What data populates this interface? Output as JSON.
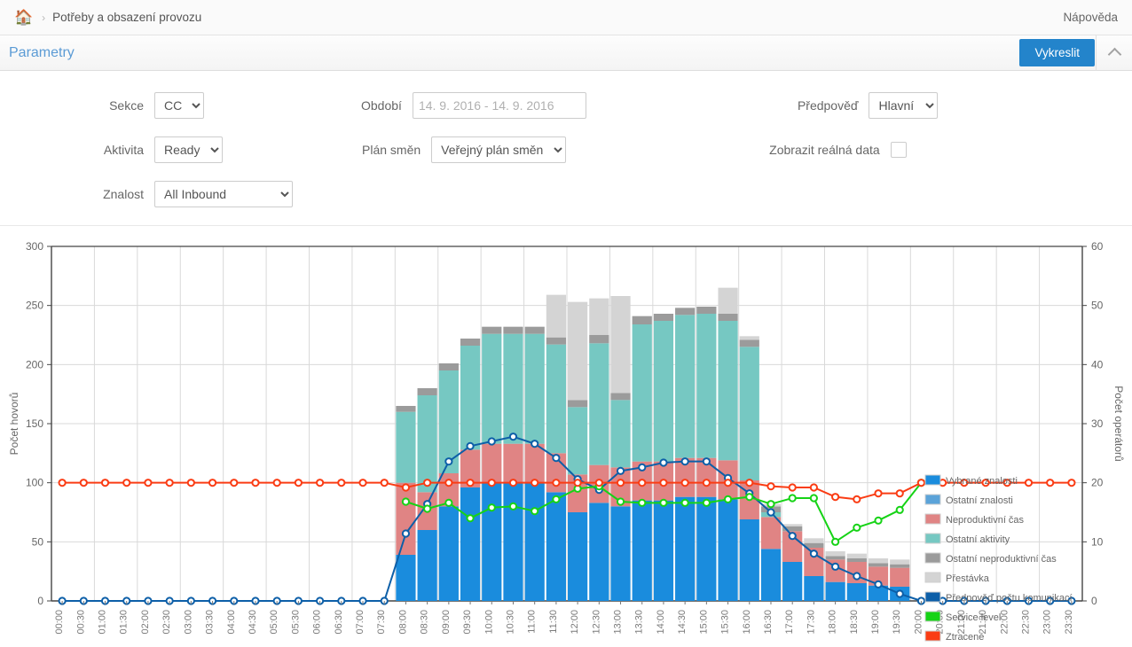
{
  "breadcrumb": {
    "home_icon": "home-icon",
    "separator": "›",
    "title": "Potřeby a obsazení provozu",
    "help": "Nápověda"
  },
  "panel": {
    "title": "Parametry",
    "draw_button": "Vykreslit",
    "collapse_icon": "chevron-up-icon"
  },
  "form": {
    "sekce_label": "Sekce",
    "sekce_value": "CC",
    "aktivita_label": "Aktivita",
    "aktivita_value": "Ready",
    "znalost_label": "Znalost",
    "znalost_value": "All Inbound",
    "obdobi_label": "Období",
    "obdobi_placeholder": "14. 9. 2016 - 14. 9. 2016",
    "obdobi_value": "",
    "plan_smen_label": "Plán směn",
    "plan_smen_value": "Veřejný plán směn",
    "predpoved_label": "Předpověď",
    "predpoved_value": "Hlavní",
    "realna_data_label": "Zobrazit reálná data",
    "realna_data_checked": false
  },
  "chart_data": {
    "type": "bar",
    "title": "",
    "xlabel": "",
    "ylabel": "Počet hovorů",
    "y2label": "Počet operátorů",
    "ylim": [
      0,
      300
    ],
    "y2lim": [
      0,
      60
    ],
    "yticks": [
      0,
      50,
      100,
      150,
      200,
      250,
      300
    ],
    "y2ticks": [
      0,
      10,
      20,
      30,
      40,
      50,
      60
    ],
    "grid": true,
    "legend_position": "top-right",
    "categories": [
      "00:00",
      "00:30",
      "01:00",
      "01:30",
      "02:00",
      "02:30",
      "03:00",
      "03:30",
      "04:00",
      "04:30",
      "05:00",
      "05:30",
      "06:00",
      "06:30",
      "07:00",
      "07:30",
      "08:00",
      "08:30",
      "09:00",
      "09:30",
      "10:00",
      "10:30",
      "11:00",
      "11:30",
      "12:00",
      "12:30",
      "13:00",
      "13:30",
      "14:00",
      "14:30",
      "15:00",
      "15:30",
      "16:00",
      "16:30",
      "17:00",
      "17:30",
      "18:00",
      "18:30",
      "19:00",
      "19:30",
      "20:00",
      "20:30",
      "21:00",
      "21:30",
      "22:00",
      "22:30",
      "23:00",
      "23:30"
    ],
    "legend": [
      {
        "label": "Vybrané znalosti",
        "color": "#1a8cdd"
      },
      {
        "label": "Ostatní znalosti",
        "color": "#5ba3d9"
      },
      {
        "label": "Neproduktivní čas",
        "color": "#e08484"
      },
      {
        "label": "Ostatní aktivity",
        "color": "#76c8c2"
      },
      {
        "label": "Ostatní neproduktivní čas",
        "color": "#9b9b9b"
      },
      {
        "label": "Přestávka",
        "color": "#d4d4d4"
      },
      {
        "label": "Předpověď počtu komunikací",
        "color": "#0d5fa8"
      },
      {
        "label": "Service level",
        "color": "#16d316"
      },
      {
        "label": "Ztracené",
        "color": "#fa3c14"
      }
    ],
    "series": [
      {
        "name": "Vybrané znalosti",
        "type": "bar",
        "axis": "right",
        "color": "#1a8cdd",
        "values": [
          0,
          0,
          0,
          0,
          0,
          0,
          0,
          0,
          0,
          0,
          0,
          0,
          0,
          0,
          0,
          0,
          7.8,
          12,
          16,
          19.2,
          20,
          20,
          20,
          18.4,
          15,
          16.6,
          16,
          17,
          17,
          17.6,
          17.6,
          17.2,
          13.8,
          8.8,
          6.6,
          4.2,
          3.2,
          3,
          2.6,
          2.4,
          0,
          0,
          0,
          0,
          0,
          0,
          0,
          0
        ]
      },
      {
        "name": "Ostatní znalosti",
        "type": "bar",
        "axis": "right",
        "color": "#5ba3d9",
        "values": [
          0,
          0,
          0,
          0,
          0,
          0,
          0,
          0,
          0,
          0,
          0,
          0,
          0,
          0,
          0,
          0,
          0,
          0,
          0,
          0,
          0,
          0,
          0,
          0,
          0,
          0,
          0,
          0,
          0,
          0,
          0,
          0,
          0,
          0,
          0,
          0,
          0,
          0,
          0,
          0,
          0,
          0,
          0,
          0,
          0,
          0,
          0,
          0
        ]
      },
      {
        "name": "Neproduktivní čas",
        "type": "bar",
        "axis": "right",
        "color": "#e08484",
        "values": [
          0,
          0,
          0,
          0,
          0,
          0,
          0,
          0,
          0,
          0,
          0,
          0,
          0,
          0,
          0,
          0,
          12.2,
          6.4,
          5.6,
          6.4,
          6.6,
          6.6,
          6.6,
          6.6,
          6.4,
          6.4,
          6.6,
          6.6,
          6.6,
          6.6,
          6.6,
          6.6,
          6.6,
          5.4,
          5.2,
          4.8,
          3.8,
          3.6,
          3.2,
          3.2,
          0,
          0,
          0,
          0,
          0,
          0,
          0,
          0
        ]
      },
      {
        "name": "Ostatní aktivity",
        "type": "bar",
        "axis": "right",
        "color": "#76c8c2",
        "values": [
          0,
          0,
          0,
          0,
          0,
          0,
          0,
          0,
          0,
          0,
          0,
          0,
          0,
          0,
          0,
          0,
          12,
          16.4,
          17.4,
          17.6,
          18.6,
          18.6,
          18.6,
          18.4,
          11.4,
          20.6,
          11.4,
          23.2,
          23.8,
          24.2,
          24.4,
          23.6,
          22.6,
          0.8,
          0,
          0,
          0,
          0,
          0,
          0,
          0,
          0,
          0,
          0,
          0,
          0,
          0,
          0
        ]
      },
      {
        "name": "Ostatní neproduktivní čas",
        "type": "bar",
        "axis": "right",
        "color": "#9b9b9b",
        "values": [
          0,
          0,
          0,
          0,
          0,
          0,
          0,
          0,
          0,
          0,
          0,
          0,
          0,
          0,
          0,
          0,
          1,
          1.2,
          1.2,
          1.2,
          1.2,
          1.2,
          1.2,
          1.2,
          1.2,
          1.4,
          1.2,
          1.4,
          1.2,
          1.2,
          1.2,
          1.2,
          1.2,
          1,
          0.8,
          0.8,
          0.6,
          0.6,
          0.6,
          0.6,
          0,
          0,
          0,
          0,
          0,
          0,
          0,
          0
        ]
      },
      {
        "name": "Přestávka",
        "type": "bar",
        "axis": "right",
        "color": "#d4d4d4",
        "values": [
          0,
          0,
          0,
          0,
          0,
          0,
          0,
          0,
          0,
          0,
          0,
          0,
          0,
          0,
          0,
          0,
          0,
          0,
          0,
          0,
          0,
          0,
          0,
          7.2,
          16.6,
          6.2,
          16.4,
          0,
          0,
          0,
          0,
          4.4,
          0.6,
          0.4,
          0.4,
          0.8,
          0.8,
          0.8,
          0.8,
          0.8,
          0,
          0,
          0,
          0,
          0,
          0,
          0,
          0
        ]
      },
      {
        "name": "Předpověď počtu komunikací",
        "type": "line",
        "axis": "left",
        "color": "#0d5fa8",
        "values": [
          0,
          0,
          0,
          0,
          0,
          0,
          0,
          0,
          0,
          0,
          0,
          0,
          0,
          0,
          0,
          0,
          57,
          82,
          118,
          131,
          135,
          139,
          133,
          121,
          103,
          94,
          110,
          113,
          117,
          118,
          118,
          104,
          91,
          75,
          55,
          40,
          29,
          21,
          14,
          6,
          0,
          0,
          0,
          0,
          0,
          0,
          0,
          0
        ]
      },
      {
        "name": "Service level",
        "type": "line",
        "axis": "left",
        "color": "#16d316",
        "values": [
          null,
          null,
          null,
          null,
          null,
          null,
          null,
          null,
          null,
          null,
          null,
          null,
          null,
          null,
          null,
          null,
          84,
          78,
          83,
          70,
          79,
          80,
          76,
          86,
          95,
          97,
          84,
          83,
          83,
          83,
          83,
          86,
          88,
          82,
          87,
          87,
          50,
          62,
          68,
          77,
          100,
          null,
          null,
          null,
          null,
          null,
          null,
          null
        ]
      },
      {
        "name": "Ztracené",
        "type": "line",
        "axis": "left",
        "color": "#fa3c14",
        "values": [
          100,
          100,
          100,
          100,
          100,
          100,
          100,
          100,
          100,
          100,
          100,
          100,
          100,
          100,
          100,
          100,
          96,
          100,
          100,
          100,
          100,
          100,
          100,
          100,
          100,
          100,
          100,
          100,
          100,
          100,
          100,
          100,
          100,
          97,
          96,
          96,
          88,
          86,
          91,
          91,
          100,
          100,
          100,
          100,
          100,
          100,
          100,
          100
        ]
      }
    ]
  }
}
